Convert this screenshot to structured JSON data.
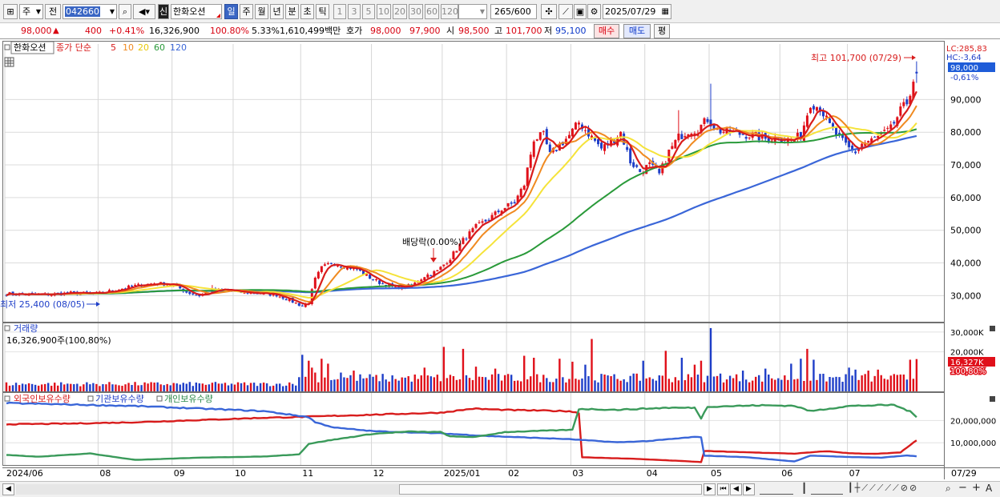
{
  "toolbar": {
    "market_select": "주",
    "prev_label": "전",
    "code_input": "042660",
    "sin_label": "신",
    "stock_name": "한화오션",
    "periods": [
      "일",
      "주",
      "월",
      "년",
      "분",
      "초",
      "틱"
    ],
    "active_period": "일",
    "intervals": [
      "1",
      "3",
      "5",
      "10",
      "20",
      "30",
      "60",
      "120"
    ],
    "count_value": "265",
    "count_total": "/600",
    "date_value": "2025/07/29"
  },
  "quote": {
    "price": "98,000",
    "change": "400",
    "change_pct": "+0.41%",
    "volume": "16,326,900",
    "volume_ratio": "100.80%",
    "turnover": "5.33%",
    "amount": "1,610,499백만",
    "bid_label": "호가",
    "bid1": "98,000",
    "bid2": "97,900",
    "open_label": "시",
    "open": "98,500",
    "high_label": "고",
    "high": "101,700",
    "low_label": "저",
    "low": "95,100",
    "buy_label": "매수",
    "sell_label": "매도",
    "lock_label": "평"
  },
  "colors": {
    "up": "#e0101a",
    "down": "#1e3ec8",
    "ma5": "#d81c1c",
    "ma10": "#f08a20",
    "ma20": "#f5e33a",
    "ma60": "#2a9a3a",
    "ma120": "#3a66d8",
    "foreign": "#d81c1c",
    "inst": "#3a66d8",
    "personal": "#3a9a5a"
  },
  "chart_data": [
    {
      "type": "candlestick",
      "name": "한화오션",
      "legend": {
        "stock": "한화오션",
        "ma_title": "종가 단순",
        "ma_periods": [
          "5",
          "10",
          "20",
          "60",
          "120"
        ]
      },
      "ylim": [
        22000,
        107000
      ],
      "y_ticks": [
        30000,
        40000,
        50000,
        60000,
        70000,
        80000,
        90000
      ],
      "y_tick_labels": [
        "30,000",
        "40,000",
        "50,000",
        "60,000",
        "70,000",
        "80,000",
        "90,000"
      ],
      "x_labels": [
        "2024/06",
        "08",
        "09",
        "10",
        "11",
        "12",
        "2025/01",
        "02",
        "03",
        "04",
        "05",
        "06",
        "07",
        "07/29"
      ],
      "x_label_pos": [
        0,
        29,
        52,
        71,
        92,
        114,
        136,
        156,
        176,
        199,
        219,
        241,
        262,
        292
      ],
      "anchors": [
        [
          0,
          30600
        ],
        [
          10,
          30200
        ],
        [
          20,
          30800
        ],
        [
          28,
          30500
        ],
        [
          34,
          31800
        ],
        [
          40,
          33000
        ],
        [
          46,
          33800
        ],
        [
          52,
          33400
        ],
        [
          56,
          31000
        ],
        [
          60,
          30000
        ],
        [
          64,
          31500
        ],
        [
          68,
          31800
        ],
        [
          72,
          31000
        ],
        [
          78,
          30800
        ],
        [
          84,
          30200
        ],
        [
          88,
          28600
        ],
        [
          92,
          26800
        ],
        [
          94,
          28000
        ],
        [
          96,
          35000
        ],
        [
          98,
          38500
        ],
        [
          101,
          40000
        ],
        [
          105,
          39000
        ],
        [
          109,
          38000
        ],
        [
          113,
          35500
        ],
        [
          117,
          33500
        ],
        [
          121,
          32500
        ],
        [
          126,
          33000
        ],
        [
          130,
          36000
        ],
        [
          134,
          37500
        ],
        [
          138,
          41500
        ],
        [
          142,
          47000
        ],
        [
          146,
          51000
        ],
        [
          150,
          53500
        ],
        [
          154,
          56500
        ],
        [
          158,
          58500
        ],
        [
          161,
          64000
        ],
        [
          164,
          78000
        ],
        [
          167,
          79000
        ],
        [
          169,
          73000
        ],
        [
          172,
          76000
        ],
        [
          175,
          79000
        ],
        [
          178,
          83000
        ],
        [
          182,
          78500
        ],
        [
          185,
          75000
        ],
        [
          188,
          77000
        ],
        [
          191,
          80000
        ],
        [
          194,
          71000
        ],
        [
          197,
          68000
        ],
        [
          200,
          70000
        ],
        [
          203,
          67000
        ],
        [
          206,
          74000
        ],
        [
          209,
          78500
        ],
        [
          212,
          80500
        ],
        [
          215,
          81000
        ],
        [
          218,
          84000
        ],
        [
          221,
          80500
        ],
        [
          225,
          80000
        ],
        [
          228,
          79500
        ],
        [
          232,
          79000
        ],
        [
          236,
          78000
        ],
        [
          240,
          78500
        ],
        [
          244,
          77500
        ],
        [
          247,
          79000
        ],
        [
          250,
          89000
        ],
        [
          253,
          87500
        ],
        [
          256,
          82000
        ],
        [
          259,
          78000
        ],
        [
          262,
          75000
        ],
        [
          264,
          74000
        ],
        [
          266,
          76500
        ],
        [
          269,
          77500
        ],
        [
          272,
          79000
        ],
        [
          275,
          81000
        ],
        [
          278,
          86500
        ],
        [
          280,
          89000
        ],
        [
          282,
          96000
        ],
        [
          283,
          98000
        ]
      ],
      "last": {
        "close": 98000,
        "open": 98500,
        "high": 101700,
        "low": 95100
      },
      "annotations": {
        "high_text": "최고 101,700 (07/29)",
        "low_text": "최저 25,400 (08/05)",
        "dividend_text": "배당락(0.00%)",
        "lc_text": "LC:285,83",
        "hc_text": "HC:-3,64",
        "price_tag": "98,000",
        "pct_tag": "-0,61%"
      }
    },
    {
      "type": "bar",
      "name": "거래량",
      "title": "거래량",
      "subtitle": "16,326,900주(100,80%)",
      "ylim": [
        0,
        34000
      ],
      "y_ticks": [
        20000,
        30000
      ],
      "y_tick_labels": [
        "20,000K",
        "30,000K"
      ],
      "unit": "K",
      "last_tag": "16,327K",
      "last_pct_tag": "100,80%",
      "spikes": [
        [
          92,
          18500
        ],
        [
          94,
          15500
        ],
        [
          95,
          12000
        ],
        [
          96,
          9500
        ],
        [
          98,
          16500
        ],
        [
          100,
          14000
        ],
        [
          104,
          9500
        ],
        [
          108,
          10500
        ],
        [
          118,
          6000
        ],
        [
          130,
          12000
        ],
        [
          136,
          22500
        ],
        [
          142,
          21500
        ],
        [
          146,
          12500
        ],
        [
          152,
          11500
        ],
        [
          161,
          18000
        ],
        [
          164,
          17000
        ],
        [
          172,
          16500
        ],
        [
          176,
          15000
        ],
        [
          180,
          13500
        ],
        [
          182,
          26500
        ],
        [
          186,
          8500
        ],
        [
          198,
          15500
        ],
        [
          205,
          20500
        ],
        [
          210,
          17000
        ],
        [
          214,
          13500
        ],
        [
          216,
          15500
        ],
        [
          219,
          32000
        ],
        [
          222,
          9000
        ],
        [
          229,
          10500
        ],
        [
          236,
          11500
        ],
        [
          244,
          14000
        ],
        [
          247,
          16500
        ],
        [
          249,
          21500
        ],
        [
          251,
          16000
        ],
        [
          262,
          12000
        ],
        [
          264,
          11000
        ],
        [
          268,
          10500
        ],
        [
          271,
          11000
        ],
        [
          281,
          16000
        ],
        [
          283,
          16327
        ]
      ]
    },
    {
      "type": "line",
      "name": "보유수량",
      "ylim": [
        0,
        32000000
      ],
      "y_ticks": [
        10000000,
        20000000
      ],
      "y_tick_labels": [
        "10,000,000",
        "20,000,000"
      ],
      "series": [
        {
          "name": "외국인보유수량",
          "anchors": [
            [
              0,
              18300000
            ],
            [
              20,
              18600000
            ],
            [
              40,
              19200000
            ],
            [
              60,
              20200000
            ],
            [
              80,
              21200000
            ],
            [
              92,
              21600000
            ],
            [
              100,
              22000000
            ],
            [
              114,
              22600000
            ],
            [
              135,
              23500000
            ],
            [
              145,
              25300000
            ],
            [
              156,
              24700000
            ],
            [
              175,
              24200000
            ],
            [
              178,
              23300000
            ],
            [
              179,
              3500000
            ],
            [
              185,
              3200000
            ],
            [
              195,
              2800000
            ],
            [
              210,
              1800000
            ],
            [
              216,
              1300000
            ],
            [
              217,
              6300000
            ],
            [
              230,
              5700000
            ],
            [
              245,
              5100000
            ],
            [
              255,
              6200000
            ],
            [
              262,
              5300000
            ],
            [
              270,
              5000000
            ],
            [
              278,
              5600000
            ],
            [
              281,
              9000000
            ],
            [
              283,
              11000000
            ]
          ]
        },
        {
          "name": "기관보유수량",
          "anchors": [
            [
              0,
              27800000
            ],
            [
              40,
              26500000
            ],
            [
              80,
              24200000
            ],
            [
              94,
              21500000
            ],
            [
              96,
              19200000
            ],
            [
              102,
              16800000
            ],
            [
              114,
              15200000
            ],
            [
              135,
              14200000
            ],
            [
              150,
              13000000
            ],
            [
              175,
              11600000
            ],
            [
              190,
              10200000
            ],
            [
              200,
              10800000
            ],
            [
              214,
              12600000
            ],
            [
              216,
              12400000
            ],
            [
              217,
              4200000
            ],
            [
              230,
              3500000
            ],
            [
              245,
              1600000
            ],
            [
              250,
              4200000
            ],
            [
              262,
              3600000
            ],
            [
              272,
              3300000
            ],
            [
              280,
              4300000
            ],
            [
              283,
              3900000
            ]
          ]
        },
        {
          "name": "개인보유수량",
          "anchors": [
            [
              0,
              4500000
            ],
            [
              10,
              3700000
            ],
            [
              26,
              5200000
            ],
            [
              40,
              2300000
            ],
            [
              60,
              3300000
            ],
            [
              80,
              3800000
            ],
            [
              91,
              4800000
            ],
            [
              94,
              9500000
            ],
            [
              100,
              11000000
            ],
            [
              114,
              14000000
            ],
            [
              125,
              15000000
            ],
            [
              135,
              14800000
            ],
            [
              138,
              12800000
            ],
            [
              146,
              12600000
            ],
            [
              155,
              14800000
            ],
            [
              176,
              15800000
            ],
            [
              178,
              25200000
            ],
            [
              190,
              24800000
            ],
            [
              205,
              25700000
            ],
            [
              214,
              25700000
            ],
            [
              216,
              21000000
            ],
            [
              218,
              26200000
            ],
            [
              235,
              26800000
            ],
            [
              245,
              26600000
            ],
            [
              250,
              24200000
            ],
            [
              262,
              26500000
            ],
            [
              276,
              27000000
            ],
            [
              281,
              24000000
            ],
            [
              283,
              21500000
            ]
          ]
        }
      ]
    }
  ]
}
